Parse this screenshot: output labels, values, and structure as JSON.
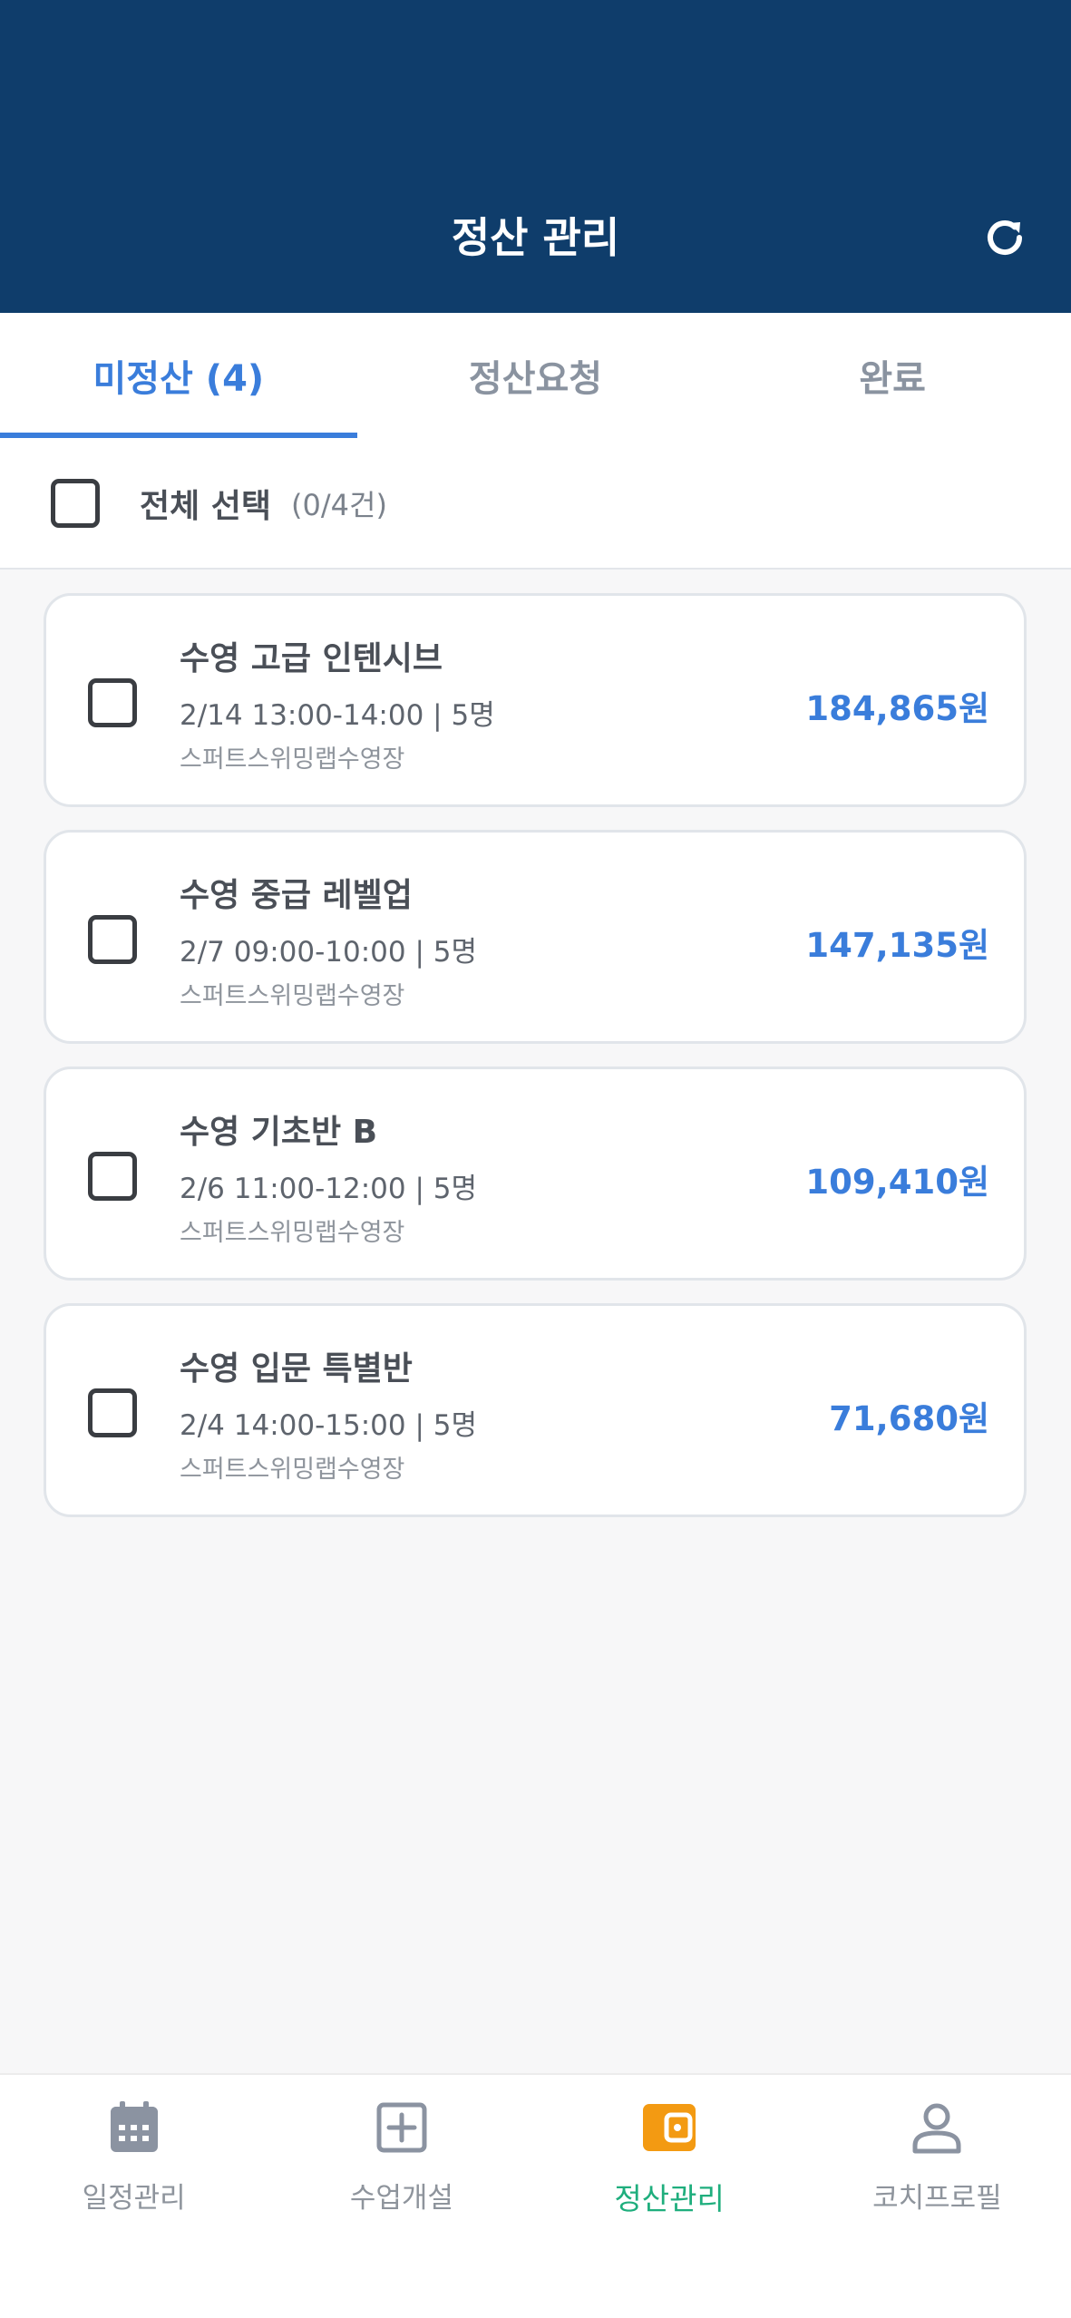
{
  "header": {
    "title": "정산 관리",
    "refresh_icon": "refresh-icon"
  },
  "tabs": [
    {
      "label": "미정산 (4)",
      "active": true
    },
    {
      "label": "정산요청",
      "active": false
    },
    {
      "label": "완료",
      "active": false
    }
  ],
  "select_all": {
    "label": "전체 선택",
    "count": "(0/4건)",
    "checked": false
  },
  "items": [
    {
      "title": "수영 고급 인텐시브",
      "meta": "2/14 13:00-14:00  |  5명",
      "place": "스퍼트스위밍랩수영장",
      "amount": "184,865원",
      "checked": false
    },
    {
      "title": "수영 중급 레벨업",
      "meta": "2/7 09:00-10:00  |  5명",
      "place": "스퍼트스위밍랩수영장",
      "amount": "147,135원",
      "checked": false
    },
    {
      "title": "수영 기초반 B",
      "meta": "2/6 11:00-12:00  |  5명",
      "place": "스퍼트스위밍랩수영장",
      "amount": "109,410원",
      "checked": false
    },
    {
      "title": "수영 입문 특별반",
      "meta": "2/4 14:00-15:00  |  5명",
      "place": "스퍼트스위밍랩수영장",
      "amount": "71,680원",
      "checked": false
    }
  ],
  "bottom_nav": [
    {
      "label": "일정관리",
      "icon": "calendar-icon",
      "active": false
    },
    {
      "label": "수업개설",
      "icon": "plus-square-icon",
      "active": false
    },
    {
      "label": "정산관리",
      "icon": "wallet-icon",
      "active": true
    },
    {
      "label": "코치프로필",
      "icon": "person-icon",
      "active": false
    }
  ],
  "colors": {
    "header_bg": "#0f3d6b",
    "accent": "#3a7ddb",
    "nav_active": "#1fae7d",
    "wallet_icon": "#f39a12"
  }
}
